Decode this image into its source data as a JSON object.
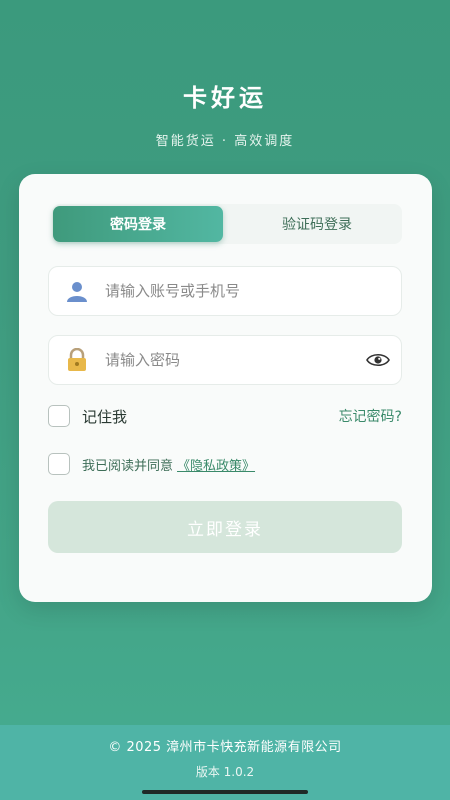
{
  "header": {
    "title": "卡好运",
    "subtitle": "智能货运 · 高效调度"
  },
  "tabs": [
    {
      "label": "密码登录",
      "active": true
    },
    {
      "label": "验证码登录",
      "active": false
    }
  ],
  "account_field": {
    "icon": "user-icon",
    "placeholder": "请输入账号或手机号",
    "value": ""
  },
  "password_field": {
    "icon": "lock-icon",
    "placeholder": "请输入密码",
    "value": "",
    "toggle_icon": "eye-icon"
  },
  "remember": {
    "label": "记住我",
    "checked": false
  },
  "forgot_label": "忘记密码?",
  "agreement": {
    "label": "我已阅读并同意",
    "link": "《隐私政策》",
    "checked": false
  },
  "login_label": "立即登录",
  "footer": {
    "copyright": "© 2025 漳州市卡快充新能源有限公司",
    "version": "版本 1.0.2"
  },
  "colors": {
    "primary": "#3f9a7c",
    "accent_link": "#3a8a6a",
    "disabled_button": "#d5e6db",
    "footer_bg": "#4fb4a6"
  }
}
